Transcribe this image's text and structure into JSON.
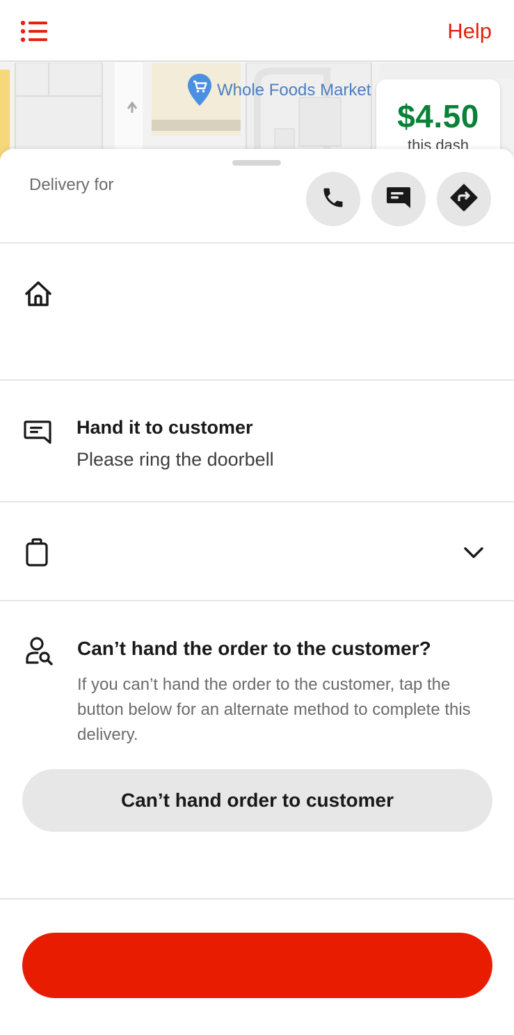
{
  "header": {
    "menu_icon": "menu-list-icon",
    "help_label": "Help",
    "accent_color": "#e8210e"
  },
  "map": {
    "store_name": "Whole Foods Market",
    "store_pin_icon": "shopping-cart-pin-icon"
  },
  "earnings": {
    "amount": "$4.50",
    "caption": "this dash",
    "amount_color": "#098237"
  },
  "delivery": {
    "label": "Delivery for",
    "actions": [
      "phone-icon",
      "message-icon",
      "directions-icon"
    ]
  },
  "address_row": {
    "icon": "home-icon"
  },
  "instructions": {
    "icon": "chat-icon",
    "title": "Hand it to customer",
    "subtitle": "Please ring the doorbell"
  },
  "order_row": {
    "icon": "bag-icon",
    "chevron": "chevron-down-icon"
  },
  "cant_hand": {
    "icon": "user-search-icon",
    "title": "Can’t hand the order to the customer?",
    "body": "If you can’t hand the order to the customer, tap the button below for an alternate method to complete this delivery.",
    "button_label": "Can’t hand order to customer"
  },
  "primary_action": {
    "color": "#e81c00"
  }
}
